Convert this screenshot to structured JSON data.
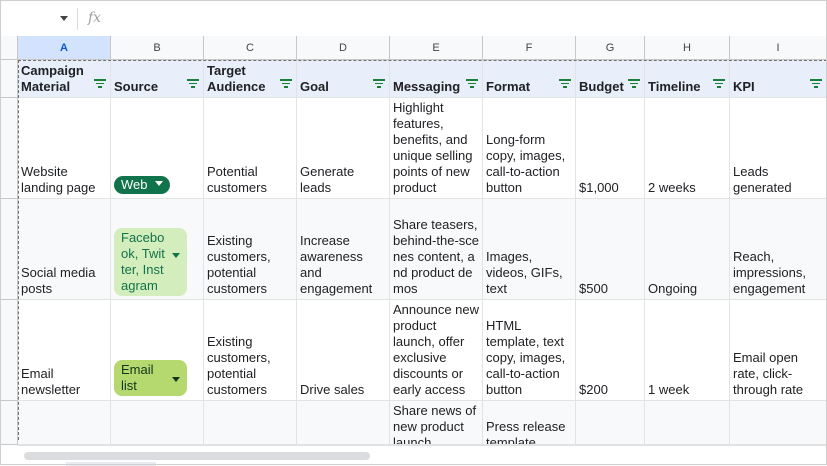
{
  "formula_bar": {
    "fx_label": "fx",
    "cell_ref": "",
    "value": ""
  },
  "columns": [
    "A",
    "B",
    "C",
    "D",
    "E",
    "F",
    "G",
    "H",
    "I"
  ],
  "headers": [
    "Campaign Material",
    "Source",
    "Target Audience",
    "Goal",
    "Messaging",
    "Format",
    "Budget",
    "Timeline",
    "KPI"
  ],
  "rows": [
    {
      "material": "Website landing page",
      "source": "Web",
      "audience": "Potential customers",
      "goal": "Generate leads",
      "messaging": "Highlight features, benefits, and unique selling points of new product",
      "format": "Long-form copy, images, call-to-action button",
      "budget": "$1,000",
      "timeline": "2 weeks",
      "kpi": "Leads generated"
    },
    {
      "material": "Social media posts",
      "source": "Facebook, Twitter, Instagram",
      "audience": "Existing customers, potential customers",
      "goal": "Increase awareness and engagement",
      "messaging": "Share teasers, behind-the-scenes content, and product demos",
      "format": "Images, videos, GIFs, text",
      "budget": "$500",
      "timeline": "Ongoing",
      "kpi": "Reach, impressions, engagement"
    },
    {
      "material": "Email newsletter",
      "source": "Email list",
      "audience": "Existing customers, potential customers",
      "goal": "Drive sales",
      "messaging": "Announce new product launch, offer exclusive discounts or early access",
      "format": "HTML template, text copy, images, call-to-action button",
      "budget": "$200",
      "timeline": "1 week",
      "kpi": "Email open rate, click-through rate"
    },
    {
      "material": "",
      "source": "",
      "audience": "",
      "goal": "",
      "messaging": "Share news of new product launch",
      "format": "Press release template",
      "budget": "",
      "timeline": "",
      "kpi": ""
    }
  ],
  "chip_colors": {
    "web": "#11734b",
    "social": "#d4edbc",
    "email": "#b5d96f"
  },
  "accent_color": "#188038"
}
